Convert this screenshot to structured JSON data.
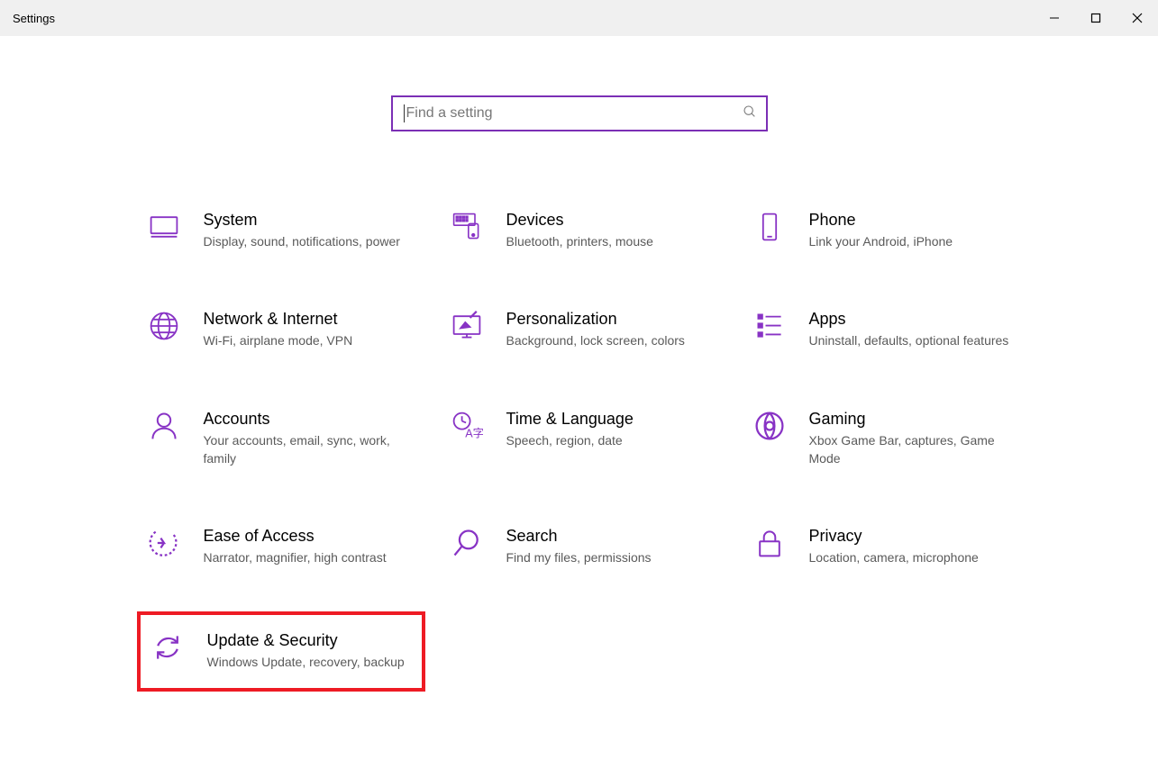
{
  "window": {
    "title": "Settings"
  },
  "search": {
    "placeholder": "Find a setting"
  },
  "tiles": [
    {
      "id": "system",
      "title": "System",
      "desc": "Display, sound, notifications, power",
      "icon": "system"
    },
    {
      "id": "devices",
      "title": "Devices",
      "desc": "Bluetooth, printers, mouse",
      "icon": "devices"
    },
    {
      "id": "phone",
      "title": "Phone",
      "desc": "Link your Android, iPhone",
      "icon": "phone"
    },
    {
      "id": "network",
      "title": "Network & Internet",
      "desc": "Wi-Fi, airplane mode, VPN",
      "icon": "network"
    },
    {
      "id": "personalization",
      "title": "Personalization",
      "desc": "Background, lock screen, colors",
      "icon": "personalization"
    },
    {
      "id": "apps",
      "title": "Apps",
      "desc": "Uninstall, defaults, optional features",
      "icon": "apps"
    },
    {
      "id": "accounts",
      "title": "Accounts",
      "desc": "Your accounts, email, sync, work, family",
      "icon": "accounts"
    },
    {
      "id": "time-language",
      "title": "Time & Language",
      "desc": "Speech, region, date",
      "icon": "time-language"
    },
    {
      "id": "gaming",
      "title": "Gaming",
      "desc": "Xbox Game Bar, captures, Game Mode",
      "icon": "gaming"
    },
    {
      "id": "ease-of-access",
      "title": "Ease of Access",
      "desc": "Narrator, magnifier, high contrast",
      "icon": "ease-of-access"
    },
    {
      "id": "search",
      "title": "Search",
      "desc": "Find my files, permissions",
      "icon": "search"
    },
    {
      "id": "privacy",
      "title": "Privacy",
      "desc": "Location, camera, microphone",
      "icon": "privacy"
    },
    {
      "id": "update-security",
      "title": "Update & Security",
      "desc": "Windows Update, recovery, backup",
      "icon": "update-security",
      "highlighted": true
    }
  ]
}
